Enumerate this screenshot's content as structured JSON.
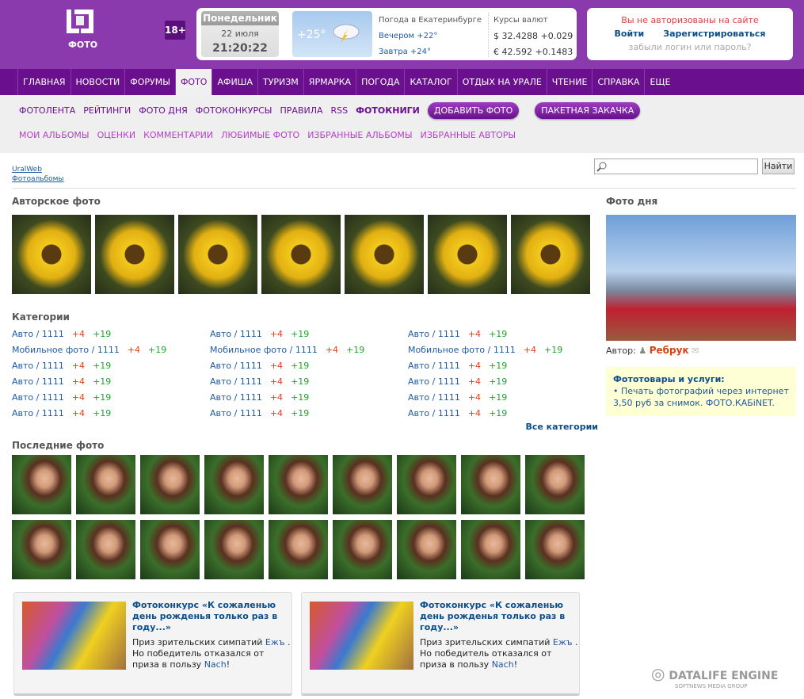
{
  "header": {
    "logo_text": "ФОТО",
    "age_badge": "18+",
    "day": "Понедельник",
    "date": "22 июля",
    "time": "21:20:22",
    "weather": {
      "temp": "+25°",
      "title": "Погода в Екатеринбурге",
      "evening": "Вечером +22°",
      "tomorrow": "Завтра +24°"
    },
    "rates": {
      "title": "Курсы валют",
      "usd": "$ 32.4288 +0.029",
      "eur": "€ 42.592 +0.1483"
    },
    "auth": {
      "message": "Вы не авторизованы на сайте",
      "login": "Войти",
      "register": "Зарегистрироваться",
      "forgot": "забыли логин или пароль?"
    }
  },
  "nav": [
    "ГЛАВНАЯ",
    "НОВОСТИ",
    "ФОРУМЫ",
    "ФОТО",
    "АФИША",
    "ТУРИЗМ",
    "ЯРМАРКА",
    "ПОГОДА",
    "КАТАЛОГ",
    "ОТДЫХ НА УРАЛЕ",
    "ЧТЕНИЕ",
    "СПРАВКА",
    "ЕЩЕ"
  ],
  "nav_active": "ФОТО",
  "subnav1": [
    "ФОТОЛЕНТА",
    "РЕЙТИНГИ",
    "ФОТО ДНЯ",
    "ФОТОКОНКУРСЫ",
    "ПРАВИЛА",
    "RSS",
    "ФОТОКНИГИ"
  ],
  "subnav_buttons": [
    "ДОБАВИТЬ ФОТО",
    "ПАКЕТНАЯ ЗАКАЧКА"
  ],
  "subnav2": [
    "МОИ АЛЬБОМЫ",
    "ОЦЕНКИ",
    "КОММЕНТАРИИ",
    "ЛЮБИМЫЕ ФОТО",
    "ИЗБРАННЫЕ АЛЬБОМЫ",
    "ИЗБРАННЫЕ АВТОРЫ"
  ],
  "breadcrumb": [
    "UralWeb",
    "Фотоальбомы"
  ],
  "search": {
    "placeholder": "",
    "button": "Найти"
  },
  "author_photos": {
    "title": "Авторское фото",
    "count": 7
  },
  "categories": {
    "title": "Категории",
    "all": "Все категории",
    "columns": [
      [
        [
          "Авто / 1111",
          "+4",
          "+19"
        ],
        [
          "Мобильное фото / 1111",
          "+4",
          "+19"
        ],
        [
          "Авто / 1111",
          "+4",
          "+19"
        ],
        [
          "Авто / 1111",
          "+4",
          "+19"
        ],
        [
          "Авто / 1111",
          "+4",
          "+19"
        ],
        [
          "Авто / 1111",
          "+4",
          "+19"
        ]
      ],
      [
        [
          "Авто / 1111",
          "+4",
          "+19"
        ],
        [
          "Мобильное фото / 1111",
          "+4",
          "+19"
        ],
        [
          "Авто / 1111",
          "+4",
          "+19"
        ],
        [
          "Авто / 1111",
          "+4",
          "+19"
        ],
        [
          "Авто / 1111",
          "+4",
          "+19"
        ],
        [
          "Авто / 1111",
          "+4",
          "+19"
        ]
      ],
      [
        [
          "Авто / 1111",
          "+4",
          "+19"
        ],
        [
          "Мобильное фото / 1111",
          "+4",
          "+19"
        ],
        [
          "Авто / 1111",
          "+4",
          "+19"
        ],
        [
          "Авто / 1111",
          "+4",
          "+19"
        ],
        [
          "Авто / 1111",
          "+4",
          "+19"
        ],
        [
          "Авто / 1111",
          "+4",
          "+19"
        ]
      ]
    ]
  },
  "latest": {
    "title": "Последние фото",
    "count": 18
  },
  "contests": [
    {
      "title": "Фотоконкурс «К сожаленью день рожденья только раз в году...»",
      "t1": "Приз зрительских симпатий ",
      "l1": "Ежъ",
      "t2": " . Но победитель отказался от приза в пользу ",
      "l2": "Nach",
      "t3": "!"
    },
    {
      "title": "Фотоконкурс «К сожаленью день рожденья только раз в году...»",
      "t1": "Приз зрительских симпатий ",
      "l1": "Ежъ",
      "t2": " . Но победитель отказался от приза в пользу ",
      "l2": "Nach",
      "t3": "!"
    }
  ],
  "photo_of_day": {
    "title": "Фото дня",
    "author_label": "Автор:",
    "author": "Ребрук"
  },
  "services": {
    "title": "Фототовары и услуги:",
    "text": "• Печать фотографий через интернет 3,50 руб за снимок. ФОТО.КАБiNET."
  },
  "footer": {
    "logo": "DATALIFE ENGINE",
    "sub": "SOFTNEWS MEDIA GROUP"
  }
}
